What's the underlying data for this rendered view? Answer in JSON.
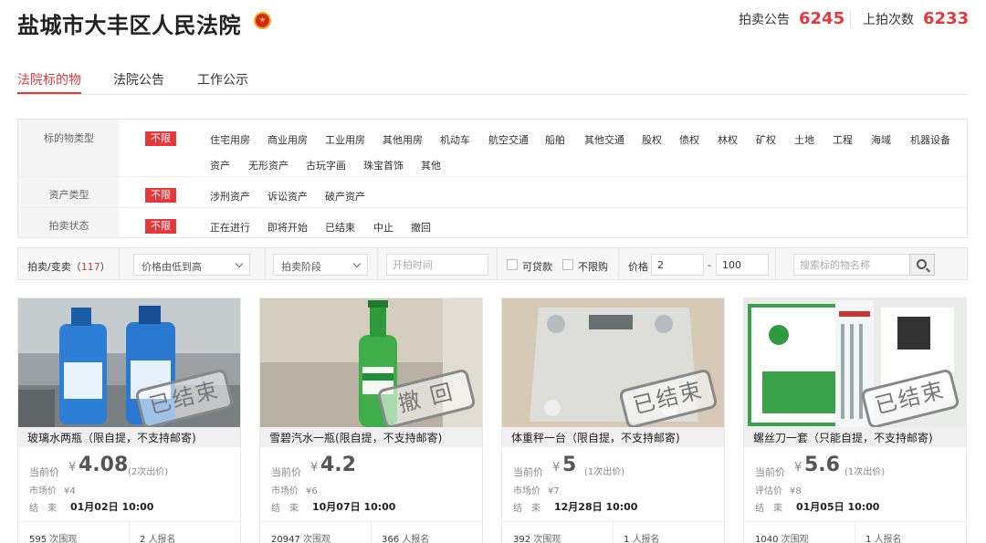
{
  "header": {
    "court_name": "盐城市大丰区人民法院",
    "stats": [
      {
        "label": "拍卖公告",
        "value": "6245"
      },
      {
        "label": "上拍次数",
        "value": "6233"
      }
    ]
  },
  "tabs": [
    "法院标的物",
    "法院公告",
    "工作公示"
  ],
  "filters": {
    "unlimited_label": "不限",
    "rows": [
      {
        "label": "标的物类型",
        "options": [
          "住宅用房",
          "商业用房",
          "工业用房",
          "其他用房",
          "机动车",
          "航空交通",
          "船舶",
          "其他交通",
          "股权",
          "债权",
          "林权",
          "矿权",
          "土地",
          "工程",
          "海域",
          "机器设备",
          "资产",
          "无形资产",
          "古玩字画",
          "珠宝首饰",
          "其他"
        ]
      },
      {
        "label": "资产类型",
        "options": [
          "涉刑资产",
          "诉讼资产",
          "破产资产"
        ]
      },
      {
        "label": "拍卖状态",
        "options": [
          "正在进行",
          "即将开始",
          "已结束",
          "中止",
          "撤回"
        ]
      }
    ]
  },
  "sortbar": {
    "count_label": "拍卖/变卖（",
    "count": "117",
    "count_close": "）",
    "sort_select": "价格由低到高",
    "stage_select": "拍卖阶段",
    "time_placeholder": "开拍时间",
    "loan_label": "可贷款",
    "unlimited_buy_label": "不限购",
    "price_label": "价格",
    "price_min": "2",
    "price_dash": "-",
    "price_max": "100",
    "search_placeholder": "搜索标的物名称"
  },
  "cards": [
    {
      "title": "玻璃水两瓶（限自提，不支持邮寄)",
      "stamp": "已结束",
      "price_label": "当前价",
      "price": "4.08",
      "bids": "(2次出价)",
      "market_label": "市场价",
      "market": "¥4",
      "end_label": "结　束",
      "end_time": "01月02日 10:00",
      "views": "595",
      "views_label": "次围观",
      "signups": "2",
      "signups_label": "人报名"
    },
    {
      "title": "雪碧汽水一瓶(限自提，不支持邮寄)",
      "stamp": "撤 回",
      "price_label": "当前价",
      "price": "4.2",
      "bids": "",
      "market_label": "市场价",
      "market": "¥6",
      "end_label": "结　束",
      "end_time": "10月07日 10:00",
      "views": "20947",
      "views_label": "次围观",
      "signups": "366",
      "signups_label": "人报名"
    },
    {
      "title": "体重秤一台（限自提，不支持邮寄)",
      "stamp": "已结束",
      "price_label": "当前价",
      "price": "5",
      "bids": "(1次出价)",
      "market_label": "市场价",
      "market": "¥7",
      "end_label": "结　束",
      "end_time": "12月28日 10:00",
      "views": "392",
      "views_label": "次围观",
      "signups": "1",
      "signups_label": "人报名"
    },
    {
      "title": "螺丝刀一套（只能自提，不支持邮寄)",
      "stamp": "已结束",
      "price_label": "当前价",
      "price": "5.6",
      "bids": "(1次出价)",
      "market_label": "评估价",
      "market": "¥8",
      "end_label": "结　束",
      "end_time": "01月05日 10:00",
      "views": "1040",
      "views_label": "次围观",
      "signups": "1",
      "signups_label": "人报名"
    }
  ],
  "colors": {
    "accent": "#e4393c"
  }
}
